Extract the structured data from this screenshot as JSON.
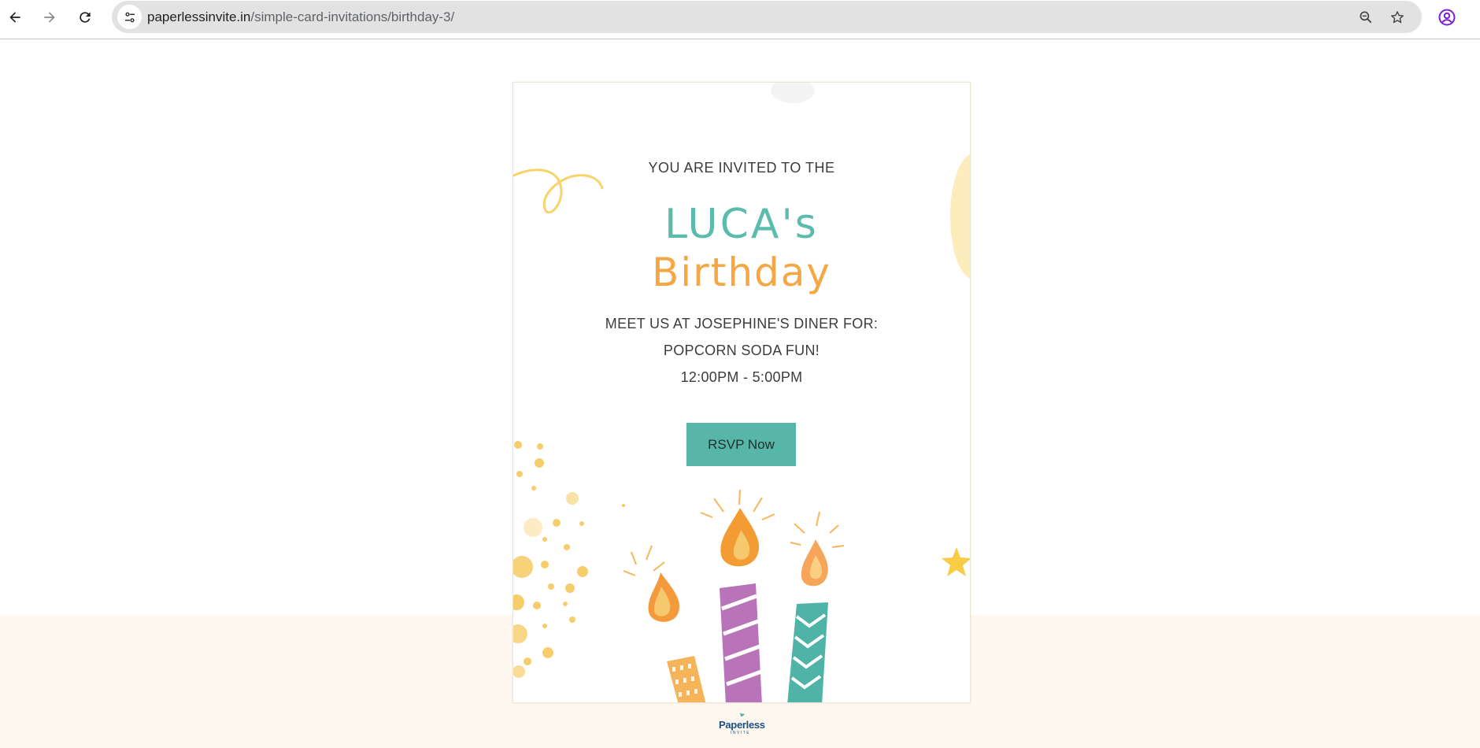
{
  "browser": {
    "url_host": "paperlessinvite.in",
    "url_path": "/simple-card-invitations/birthday-3/",
    "icons": {
      "back": "back-arrow-icon",
      "forward": "forward-arrow-icon",
      "reload": "reload-icon",
      "site_info": "tune-icon",
      "zoom": "zoom-out-icon",
      "bookmark": "star-icon",
      "profile": "account-circle-icon"
    }
  },
  "card": {
    "invited_line": "YOU ARE INVITED TO THE",
    "name": "LUCA's",
    "occasion": "Birthday",
    "details": [
      "MEET US AT JOSEPHINE'S DINER FOR:",
      "POPCORN SODA FUN!",
      "12:00PM - 5:00PM"
    ],
    "rsvp_label": "RSVP Now"
  },
  "footer": {
    "logo_text": "Paperless",
    "logo_sub": "INVITE"
  },
  "colors": {
    "teal": "#5bbcad",
    "orange": "#f4a742",
    "button": "#58b6a8",
    "band": "#fff8f1",
    "profile": "#7b1fd1"
  }
}
